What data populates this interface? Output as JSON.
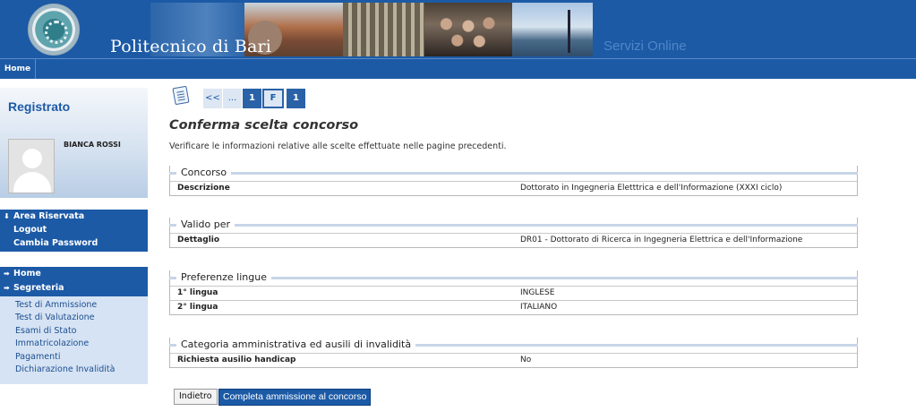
{
  "header": {
    "site_title": "Politecnico di Bari",
    "services_label": "Servizi Online"
  },
  "topnav": {
    "home": "Home"
  },
  "sidebar": {
    "user_title": "Registrato",
    "user_name": "BIANCA ROSSI",
    "area_menu": {
      "head": "Area Riservata",
      "items": [
        "Logout",
        "Cambia Password"
      ]
    },
    "sec_menu": {
      "home": "Home",
      "segreteria": "Segreteria",
      "items": [
        "Test di Ammissione",
        "Test di Valutazione",
        "Esami di Stato",
        "Immatricolazione",
        "Pagamenti",
        "Dichiarazione Invalidità"
      ]
    }
  },
  "pager": [
    "<<",
    "...",
    "1",
    "F",
    "1"
  ],
  "main": {
    "title": "Conferma scelta concorso",
    "description": "Verificare le informazioni relative alle scelte effettuate nelle pagine precedenti.",
    "sections": [
      {
        "legend": "Concorso",
        "rows": [
          {
            "key": "Descrizione",
            "value": "Dottorato in Ingegneria Eletttrica e dell'Informazione (XXXI ciclo)"
          }
        ]
      },
      {
        "legend": "Valido per",
        "rows": [
          {
            "key": "Dettaglio",
            "value": "DR01 - Dottorato di Ricerca in Ingegneria Elettrica e dell'Informazione"
          }
        ]
      },
      {
        "legend": "Preferenze lingue",
        "rows": [
          {
            "key": "1° lingua",
            "value": "INGLESE"
          },
          {
            "key": "2° lingua",
            "value": "ITALIANO"
          }
        ]
      },
      {
        "legend": "Categoria amministrativa ed ausili di invalidità",
        "rows": [
          {
            "key": "Richiesta ausilio handicap",
            "value": "No"
          }
        ]
      }
    ],
    "buttons": {
      "back": "Indietro",
      "complete": "Completa ammissione al concorso"
    }
  }
}
